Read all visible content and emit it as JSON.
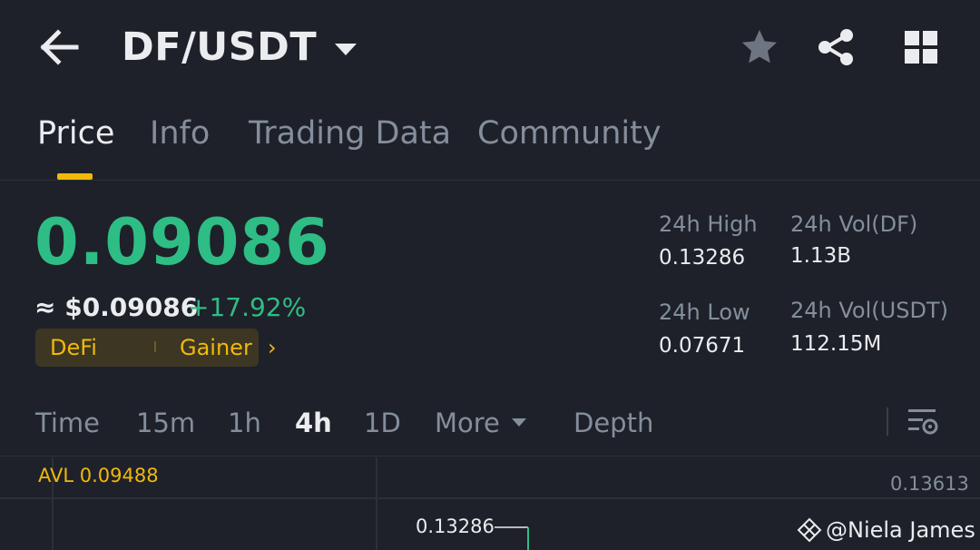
{
  "header": {
    "pair": "DF/USDT"
  },
  "tabs": [
    {
      "label": "Price",
      "active": true
    },
    {
      "label": "Info",
      "active": false
    },
    {
      "label": "Trading Data",
      "active": false
    },
    {
      "label": "Community",
      "active": false
    }
  ],
  "ticker": {
    "last_price": "0.09086",
    "fiat_price": "≈ $0.09086",
    "change_pct": "+17.92%",
    "tags": [
      "DeFi",
      "Gainer"
    ]
  },
  "stats": {
    "high_label": "24h High",
    "high_value": "0.13286",
    "low_label": "24h Low",
    "low_value": "0.07671",
    "vol_base_label": "24h Vol(DF)",
    "vol_base_value": "1.13B",
    "vol_quote_label": "24h Vol(USDT)",
    "vol_quote_value": "112.15M"
  },
  "intervals": [
    {
      "label": "Time",
      "active": false
    },
    {
      "label": "15m",
      "active": false
    },
    {
      "label": "1h",
      "active": false
    },
    {
      "label": "4h",
      "active": true
    },
    {
      "label": "1D",
      "active": false
    },
    {
      "label": "More",
      "active": false
    },
    {
      "label": "Depth",
      "active": false
    }
  ],
  "chart": {
    "avl_label": "AVL 0.09488",
    "y_max": "0.13613",
    "high_marker": "0.13286"
  },
  "watermark": "@Niela James",
  "colors": {
    "background": "#1e2129",
    "up_green": "#2ebd85",
    "accent_yellow": "#f0b90b",
    "muted_text": "#848e9c",
    "primary_text": "#eaecef"
  }
}
